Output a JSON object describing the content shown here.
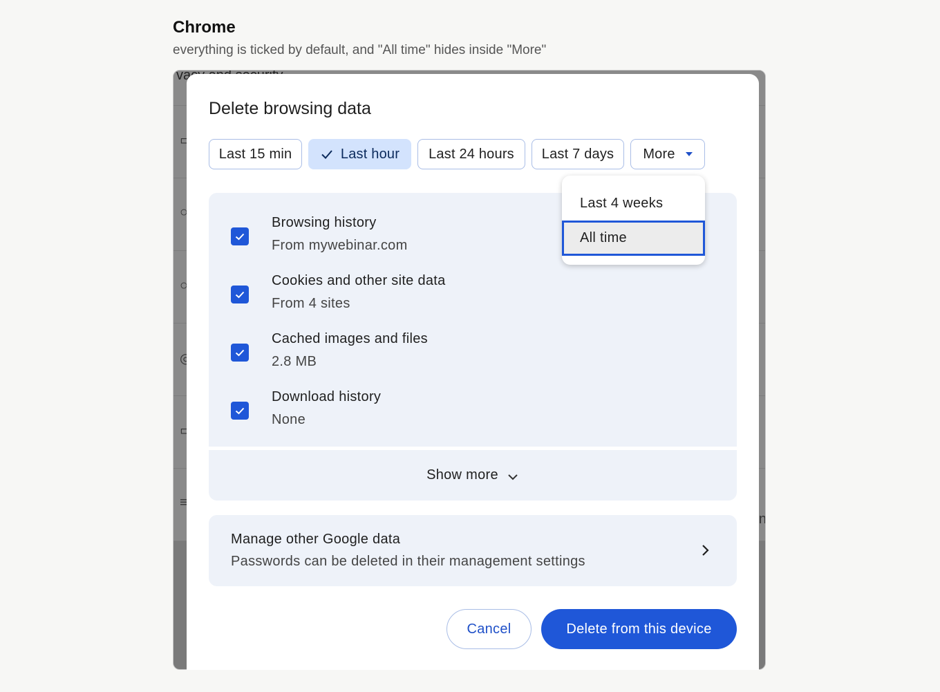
{
  "page": {
    "heading": "Chrome",
    "subheading": "everything is ticked by default, and \"All time\" hides inside \"More\""
  },
  "background": {
    "breadcrumb": "vacy and security"
  },
  "dialog": {
    "title": "Delete browsing data",
    "time_ranges": [
      {
        "label": "Last 15 min",
        "selected": false
      },
      {
        "label": "Last hour",
        "selected": true
      },
      {
        "label": "Last 24 hours",
        "selected": false
      },
      {
        "label": "Last 7 days",
        "selected": false
      },
      {
        "label": "More",
        "selected": false
      }
    ],
    "more_menu": {
      "items": [
        {
          "label": "Last 4 weeks",
          "focused": false
        },
        {
          "label": "All time",
          "focused": true
        }
      ]
    },
    "data_types": [
      {
        "title": "Browsing history",
        "detail": "From mywebinar.com",
        "checked": true
      },
      {
        "title": "Cookies and other site data",
        "detail": "From 4 sites",
        "checked": true
      },
      {
        "title": "Cached images and files",
        "detail": "2.8 MB",
        "checked": true
      },
      {
        "title": "Download history",
        "detail": "None",
        "checked": true
      }
    ],
    "show_more_label": "Show more",
    "manage": {
      "title": "Manage other Google data",
      "subtitle": "Passwords can be deleted in their management settings"
    },
    "cancel_label": "Cancel",
    "delete_label": "Delete from this device"
  },
  "colors": {
    "accent": "#1f57d8",
    "chip_selected_bg": "#d3e3fd",
    "panel_bg": "#eef2f9",
    "scrim": "#7a7a7a"
  },
  "icons": {
    "chip_check": "check-icon",
    "more_caret": "caret-down-icon",
    "checkbox": "checkbox-checked-icon",
    "show_more": "chevron-down-icon",
    "manage_arrow": "chevron-right-icon"
  }
}
